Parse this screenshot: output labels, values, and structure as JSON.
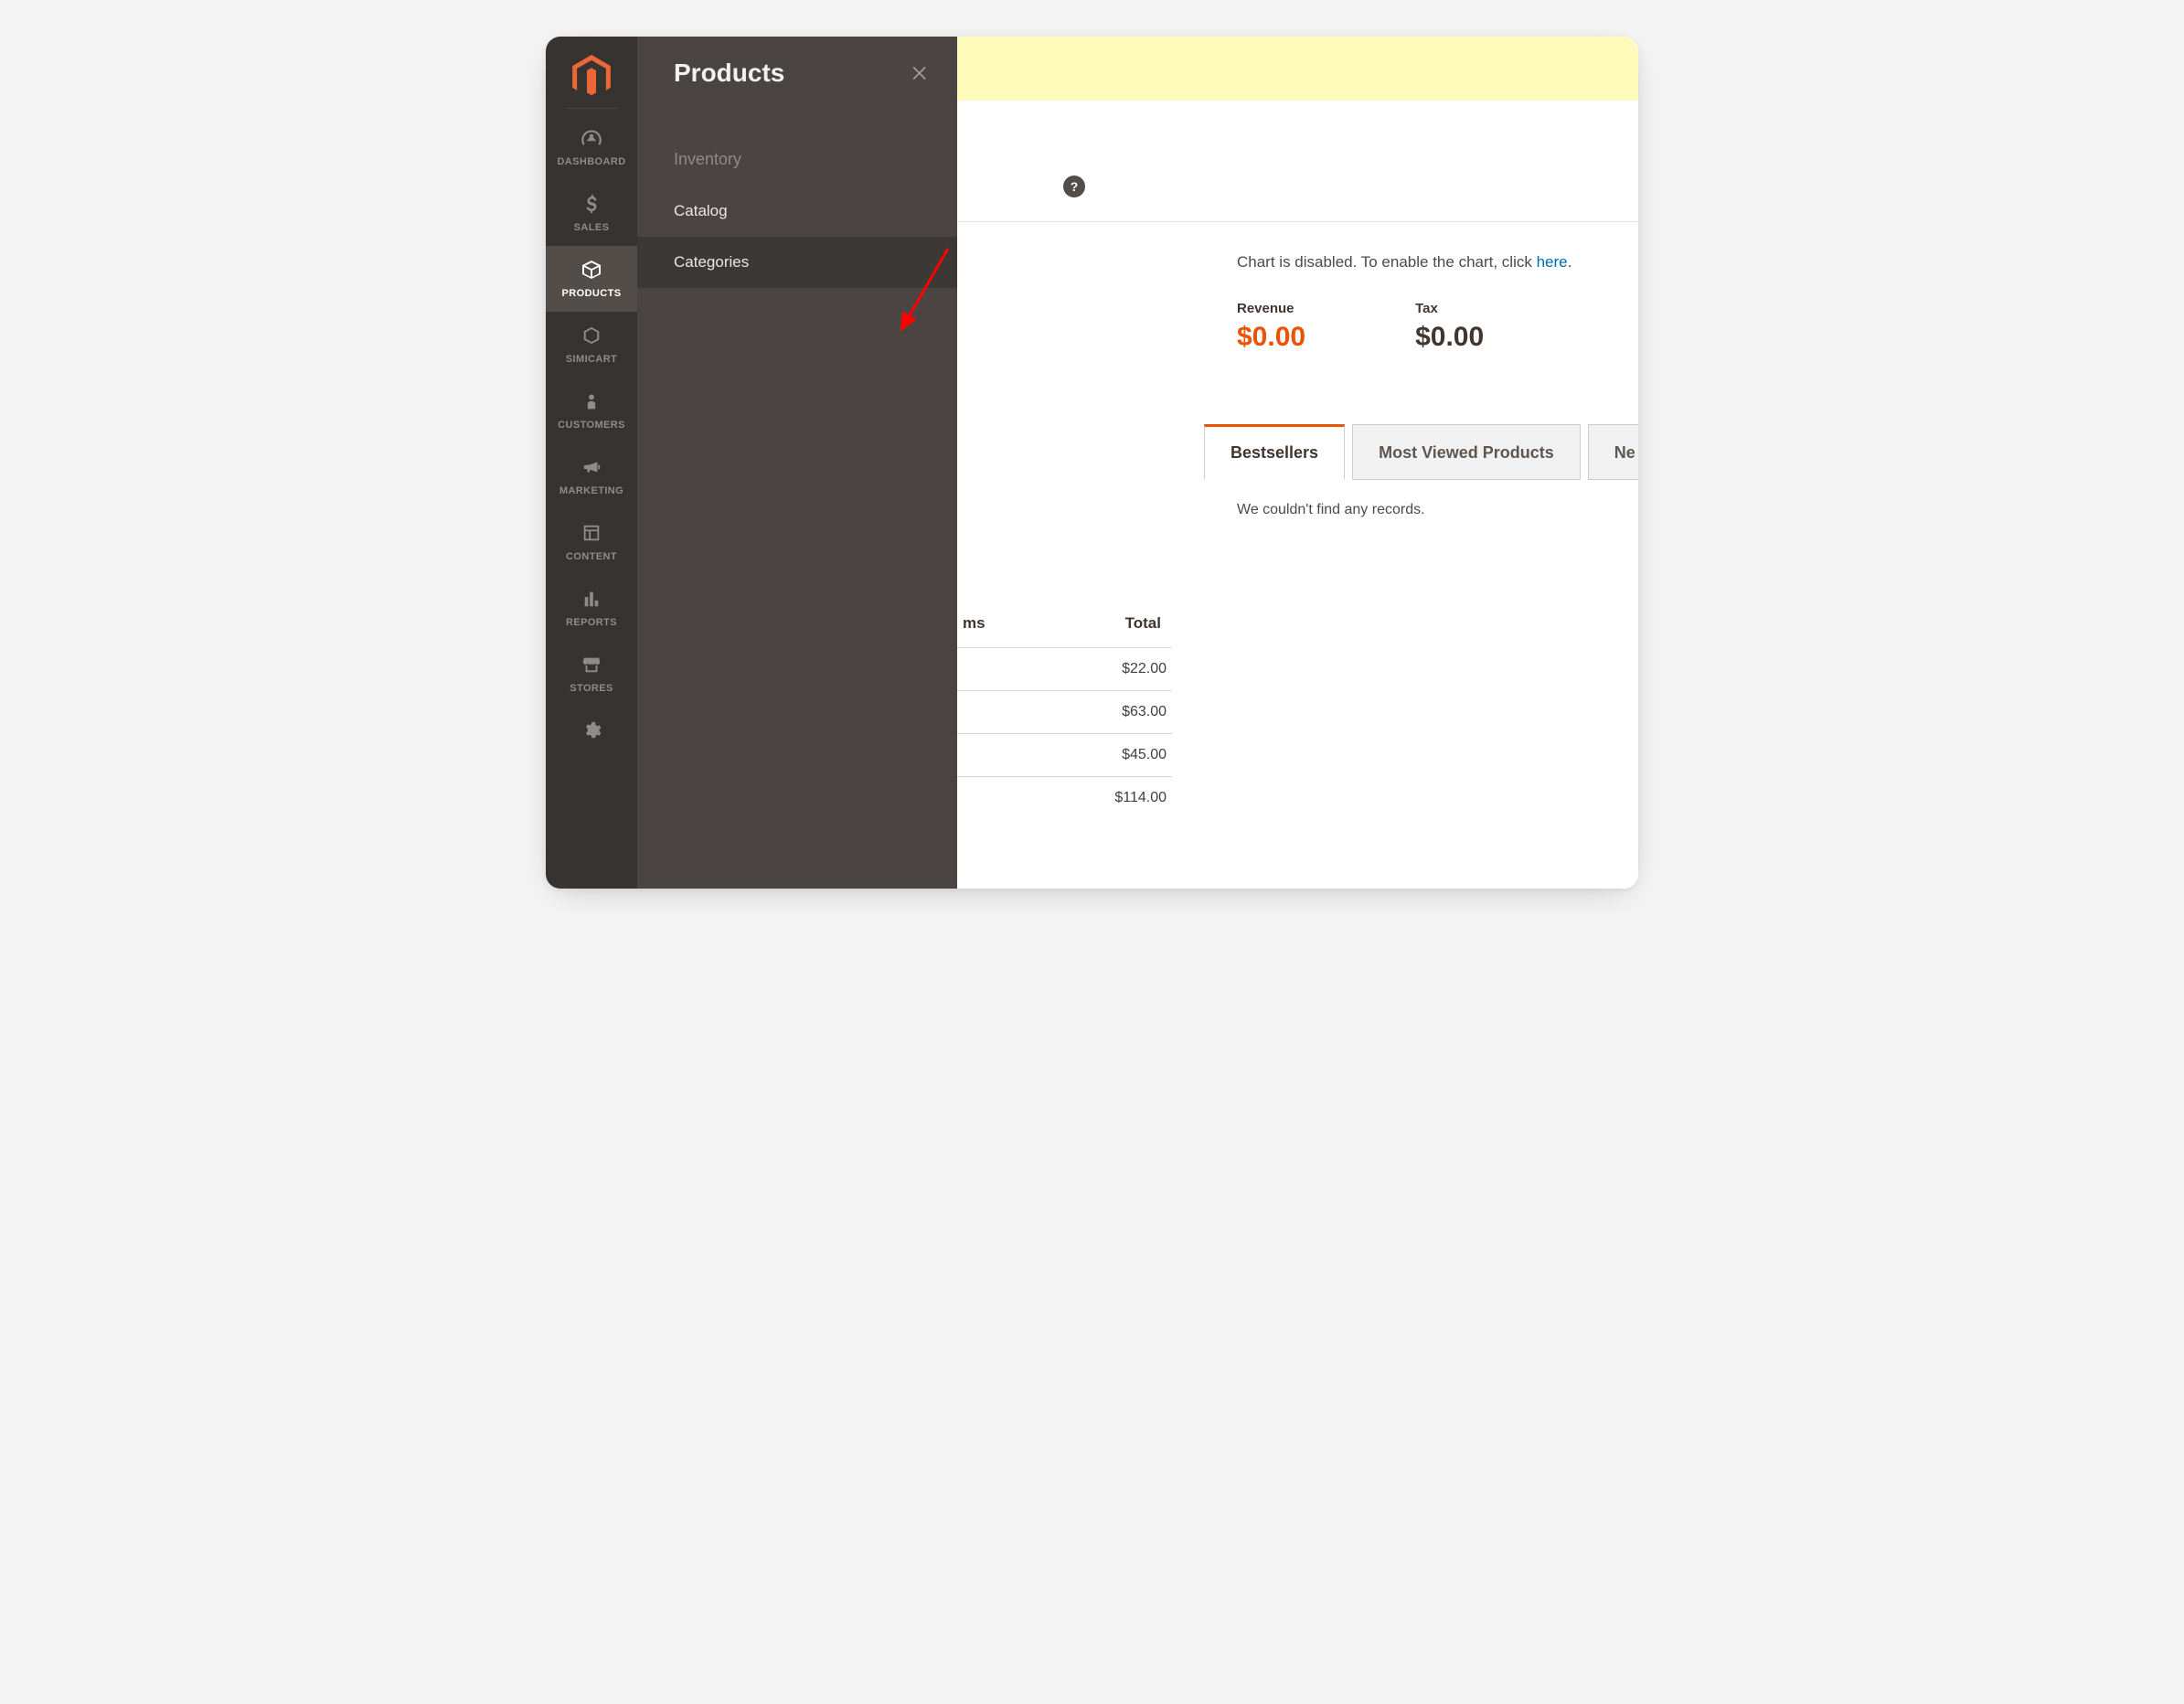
{
  "sidenav": [
    {
      "key": "dashboard",
      "label": "DASHBOARD"
    },
    {
      "key": "sales",
      "label": "SALES"
    },
    {
      "key": "products",
      "label": "PRODUCTS"
    },
    {
      "key": "simicart",
      "label": "SIMICART"
    },
    {
      "key": "customers",
      "label": "CUSTOMERS"
    },
    {
      "key": "marketing",
      "label": "MARKETING"
    },
    {
      "key": "content",
      "label": "CONTENT"
    },
    {
      "key": "reports",
      "label": "REPORTS"
    },
    {
      "key": "stores",
      "label": "STORES"
    },
    {
      "key": "system",
      "label": ""
    }
  ],
  "submenu": {
    "title": "Products",
    "section": "Inventory",
    "items": [
      {
        "label": "Catalog"
      },
      {
        "label": "Categories"
      }
    ]
  },
  "chart_msg": {
    "prefix": "Chart is disabled. To enable the chart, click ",
    "link": "here",
    "suffix": "."
  },
  "stats": {
    "revenue": {
      "label": "Revenue",
      "value": "$0.00"
    },
    "tax": {
      "label": "Tax",
      "value": "$0.00"
    }
  },
  "tabs": [
    {
      "label": "Bestsellers"
    },
    {
      "label": "Most Viewed Products"
    },
    {
      "label": "Ne"
    }
  ],
  "tab_panel_msg": "We couldn't find any records.",
  "mini_table": {
    "col_partial": "ms",
    "col_total": "Total",
    "rows": [
      "$22.00",
      "$63.00",
      "$45.00",
      "$114.00"
    ]
  }
}
